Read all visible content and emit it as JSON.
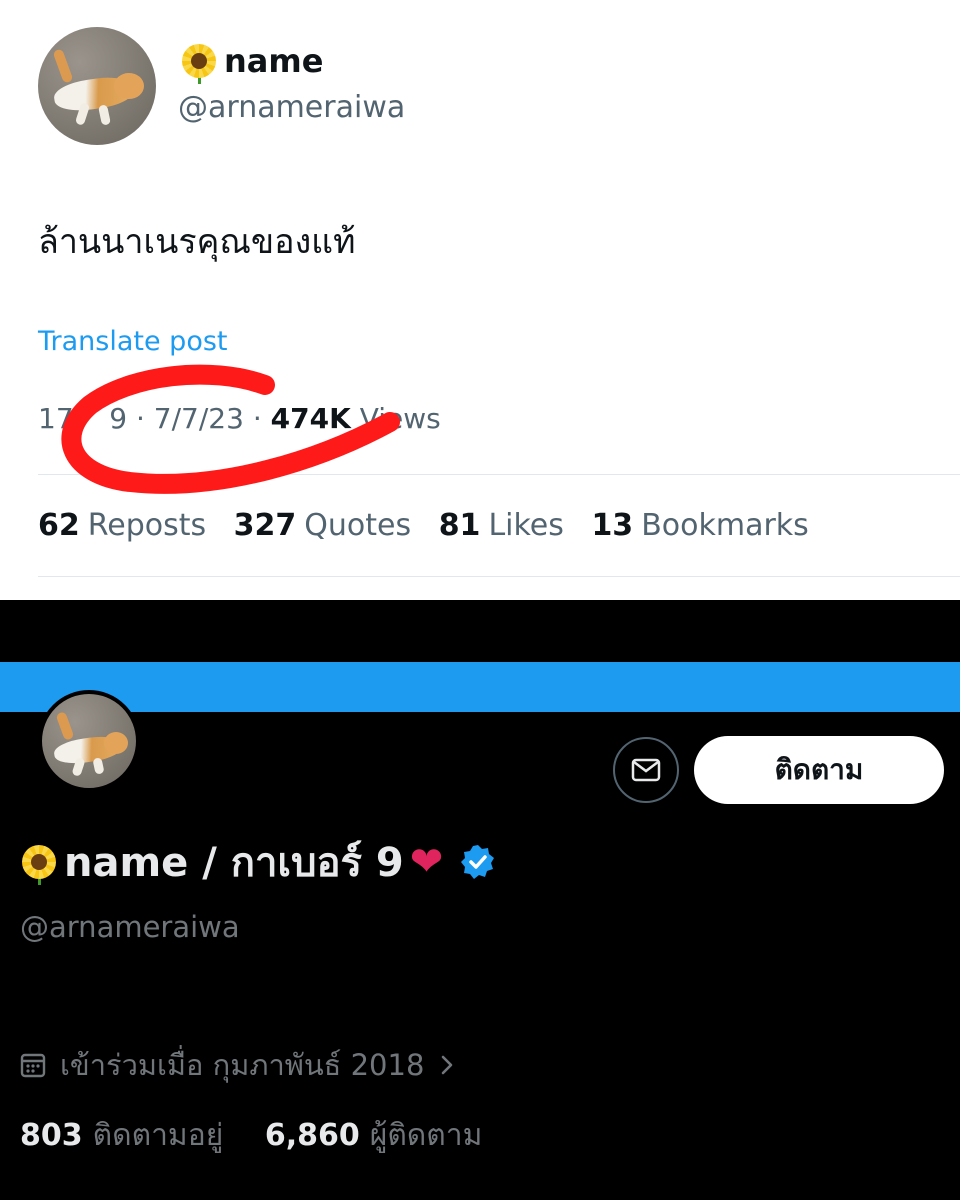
{
  "post": {
    "display_name": "name",
    "handle": "@arnameraiwa",
    "text": "ล้านนาเนรคุณของแท้",
    "translate_label": "Translate post",
    "time_partial": "17",
    "time_partial2": "9",
    "separator": "·",
    "date": "7/7/23",
    "views_count": "474K",
    "views_label": "Views",
    "stats": [
      {
        "count": "62",
        "label": "Reposts"
      },
      {
        "count": "327",
        "label": "Quotes"
      },
      {
        "count": "81",
        "label": "Likes"
      },
      {
        "count": "13",
        "label": "Bookmarks"
      }
    ]
  },
  "profile": {
    "display_name": "name / กาเบอร์ 9",
    "heart_glyph": "❤",
    "handle": "@arnameraiwa",
    "follow_label": "ติดตาม",
    "joined": "เข้าร่วมเมื่อ กุมภาพันธ์ 2018",
    "following_count": "803",
    "following_label": "ติดตามอยู่",
    "followers_count": "6,860",
    "followers_label": "ผู้ติดตาม"
  },
  "icons": {
    "message": "envelope-icon",
    "verified": "verified-badge-icon",
    "calendar": "calendar-icon",
    "chevron": "chevron-right-icon",
    "sunflower": "sunflower-emoji-icon"
  },
  "colors": {
    "accent": "#1d9bf0",
    "annotation_red": "#ff1a1a",
    "dark_bg": "#000000"
  }
}
